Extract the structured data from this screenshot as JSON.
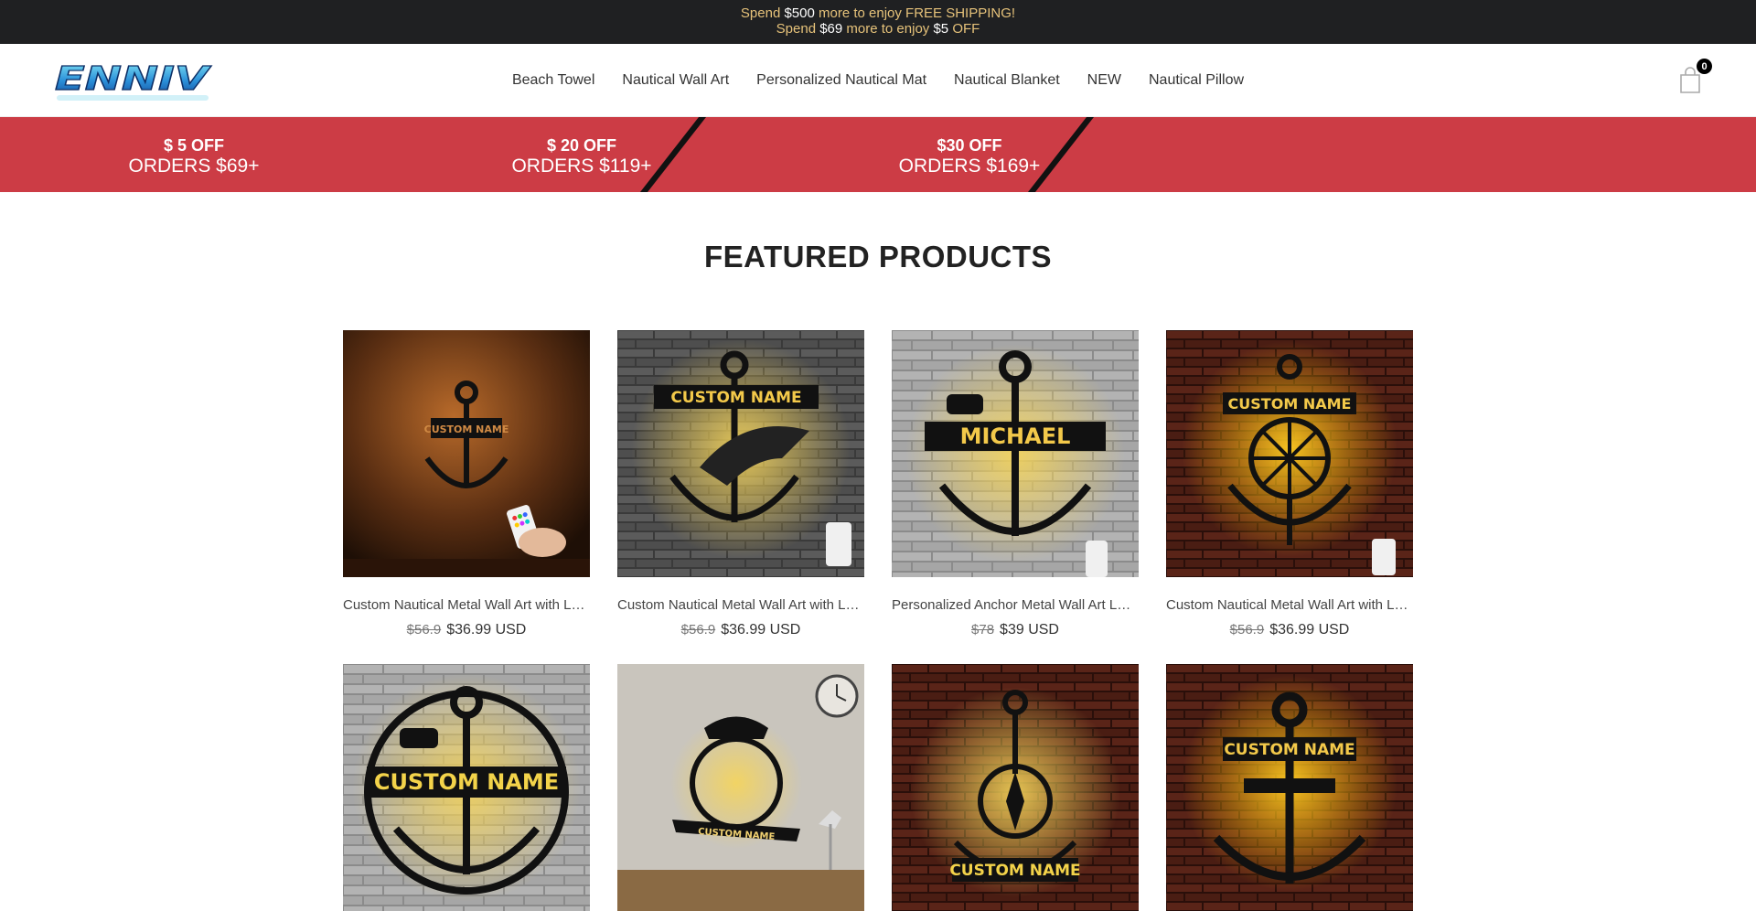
{
  "announcement": {
    "line1": {
      "pre": "Spend ",
      "amount": "$500",
      "post": " more to enjoy FREE SHIPPING!"
    },
    "line2": {
      "pre": "Spend ",
      "amount": "$69",
      "mid": " more to enjoy ",
      "discount": "$5",
      "post": " OFF"
    }
  },
  "header": {
    "logo_text": "ENNIV",
    "nav": [
      "Beach Towel",
      "Nautical Wall Art",
      "Personalized Nautical Mat",
      "Nautical Blanket",
      "NEW",
      "Nautical Pillow"
    ],
    "cart_count": "0",
    "cart_icon": "shopping-bag-icon"
  },
  "promo": [
    {
      "off": "$ 5 OFF",
      "orders": "ORDERS $69+"
    },
    {
      "off": "$ 20 OFF",
      "orders": "ORDERS $119+"
    },
    {
      "off": "$30 OFF",
      "orders": "ORDERS $169+"
    }
  ],
  "colors": {
    "announce_bg": "#1f2022",
    "announce_text": "#e6c27a",
    "promo_bg": "#cc3c45"
  },
  "featured": {
    "title": "FEATURED PRODUCTS",
    "products": [
      {
        "title": "Custom Nautical Metal Wall Art with LED Light",
        "old_price": "$56.9",
        "price": "$36.99 USD",
        "image_text": "CUSTOM NAME"
      },
      {
        "title": "Custom Nautical Metal Wall Art with LED Light",
        "old_price": "$56.9",
        "price": "$36.99 USD",
        "image_text": "CUSTOM NAME"
      },
      {
        "title": "Personalized Anchor Metal Wall Art LED Light",
        "old_price": "$78",
        "price": "$39 USD",
        "image_text": "MICHAEL"
      },
      {
        "title": "Custom Nautical Metal Wall Art with LED Light",
        "old_price": "$56.9",
        "price": "$36.99 USD",
        "image_text": "CUSTOM NAME"
      },
      {
        "title": "",
        "old_price": "",
        "price": "",
        "image_text": "CUSTOM NAME"
      },
      {
        "title": "",
        "old_price": "",
        "price": "",
        "image_text": "CUSTOM NAME"
      },
      {
        "title": "",
        "old_price": "",
        "price": "",
        "image_text": "CUSTOM NAME"
      },
      {
        "title": "",
        "old_price": "",
        "price": "",
        "image_text": "CUSTOM NAME"
      }
    ]
  }
}
